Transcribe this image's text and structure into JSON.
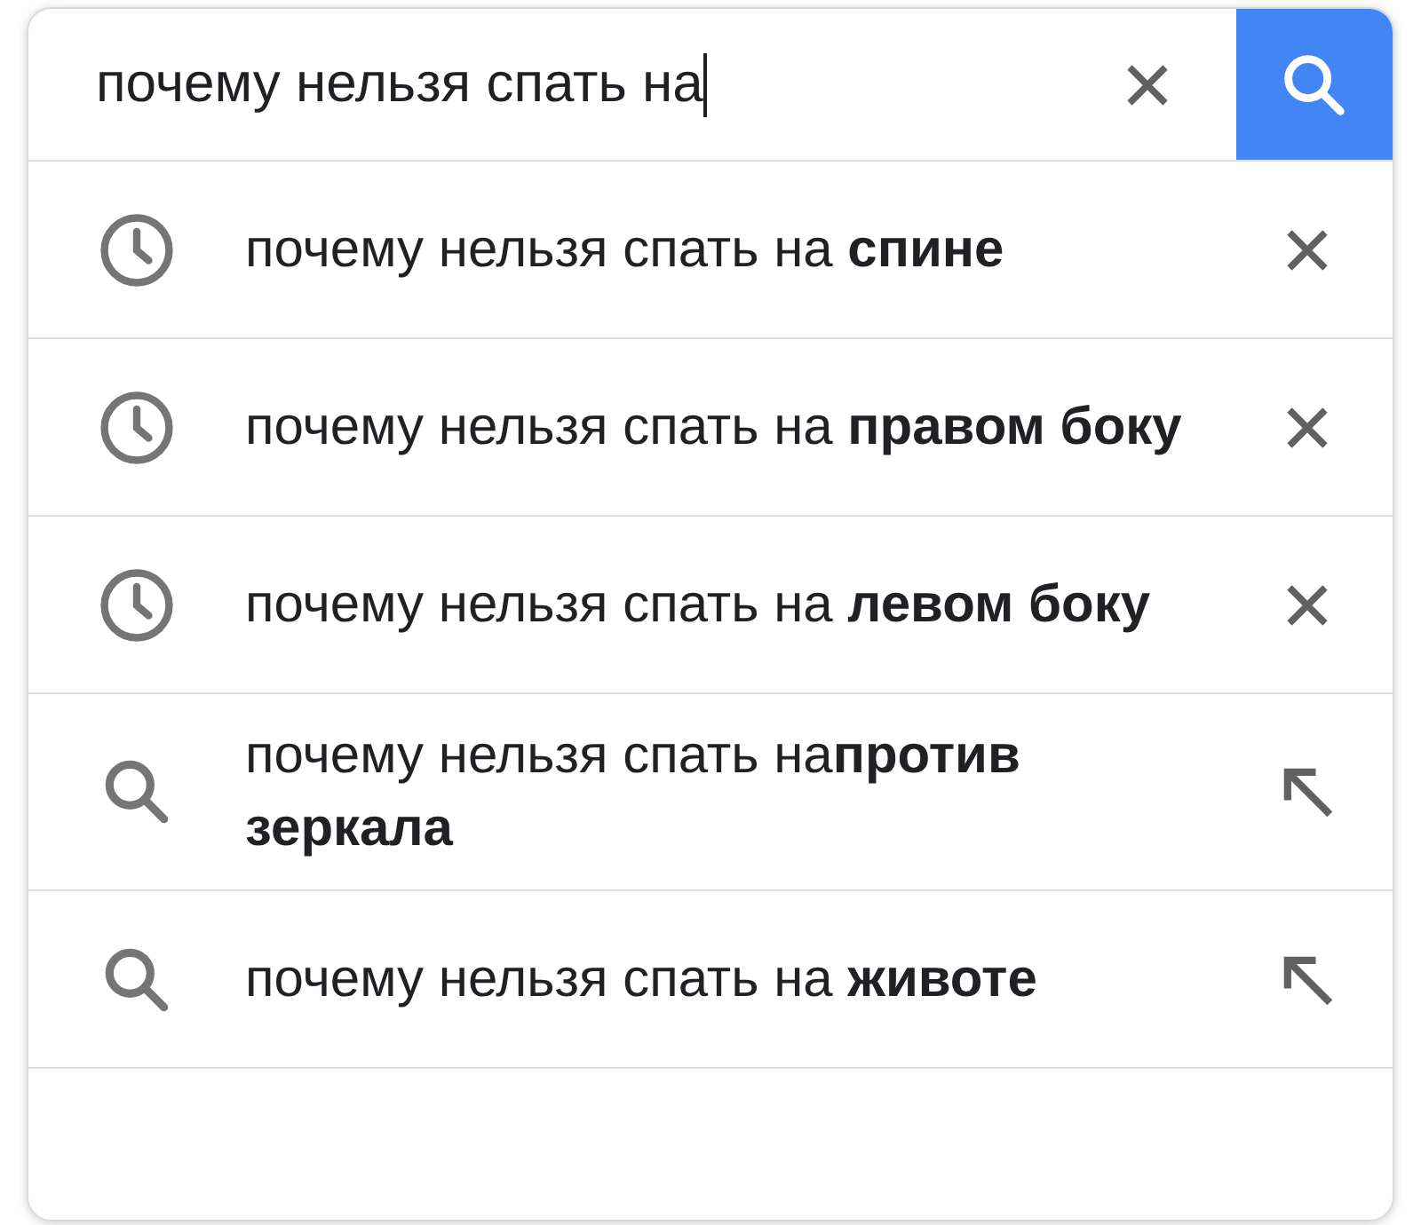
{
  "search": {
    "value": "почему нельзя спать на"
  },
  "suggestions": [
    {
      "kind": "history",
      "text": "почему нельзя спать на **спине**"
    },
    {
      "kind": "history",
      "text": "почему нельзя спать на **правом боку**"
    },
    {
      "kind": "history",
      "text": "почему нельзя спать на **левом боку**"
    },
    {
      "kind": "search",
      "text": "почему нельзя спать на**против зеркала**"
    },
    {
      "kind": "search",
      "text": "почему нельзя спать на **животе**"
    }
  ]
}
